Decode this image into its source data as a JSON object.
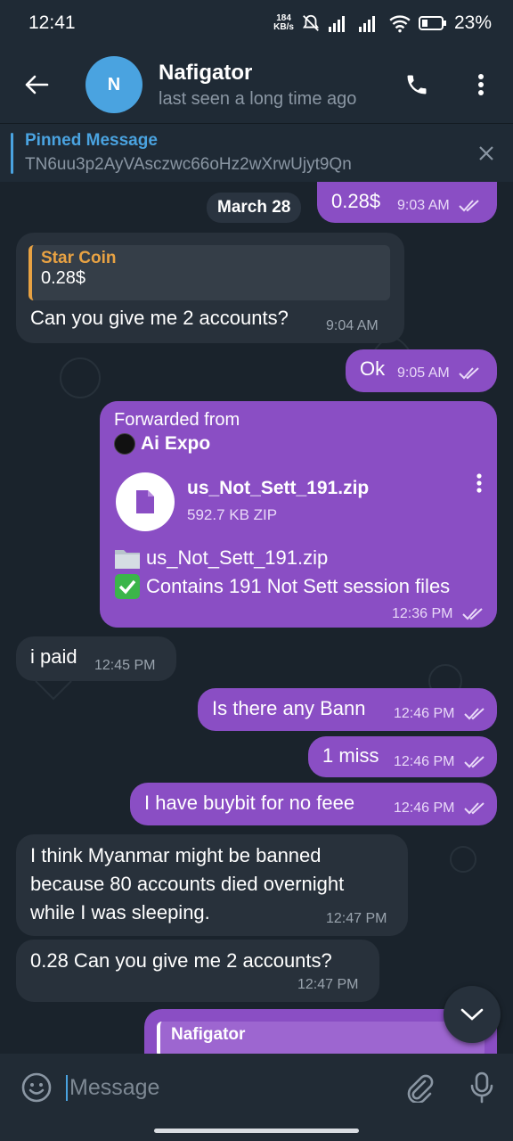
{
  "status_bar": {
    "time": "12:41",
    "net_speed_value": "184",
    "net_speed_unit": "KB/s",
    "battery": "23%"
  },
  "header": {
    "avatar_letter": "N",
    "name": "Nafigator",
    "status": "last seen a long time ago"
  },
  "pinned": {
    "label": "Pinned Message",
    "value": "TN6uu3p2AyVAsczwc66oHz2wXrwUjyt9Qn"
  },
  "chat": {
    "date": "March 28",
    "messages": [
      {
        "text": "0.28$",
        "time": "9:03 AM"
      },
      {
        "quote_name": "Star Coin",
        "quote_value": "0.28$",
        "text": "Can you give me 2 accounts?",
        "time": "9:04 AM"
      },
      {
        "text": "Ok",
        "time": "9:05 AM"
      },
      {
        "forwarded_label": "Forwarded from",
        "forwarded_source": "Ai Expo",
        "file_name": "us_Not_Sett_191.zip",
        "file_size": "592.7 KB ZIP",
        "caption_line1": "us_Not_Sett_191.zip",
        "caption_line2": "Contains 191 Not Sett session files",
        "time": "12:36 PM"
      },
      {
        "text": "i paid",
        "time": "12:45 PM"
      },
      {
        "text": "Is there any Bann",
        "time": "12:46 PM"
      },
      {
        "text": "1 miss",
        "time": "12:46 PM"
      },
      {
        "text": "I have buybit for no feee",
        "time": "12:46 PM"
      },
      {
        "line1": "I think Myanmar might be banned",
        "line2": "because 80 accounts died overnight",
        "line3": "while I was sleeping.",
        "time": "12:47 PM"
      },
      {
        "text": "0.28 Can you give me 2 accounts?",
        "time": "12:47 PM"
      },
      {
        "quote_name": "Nafigator"
      }
    ]
  },
  "input": {
    "placeholder": "Message"
  },
  "colors": {
    "accent": "#4aa3e0",
    "outgoing_bubble": "#8a4ec4",
    "incoming_bubble": "#28313b",
    "quote_accent": "#e8a243"
  }
}
